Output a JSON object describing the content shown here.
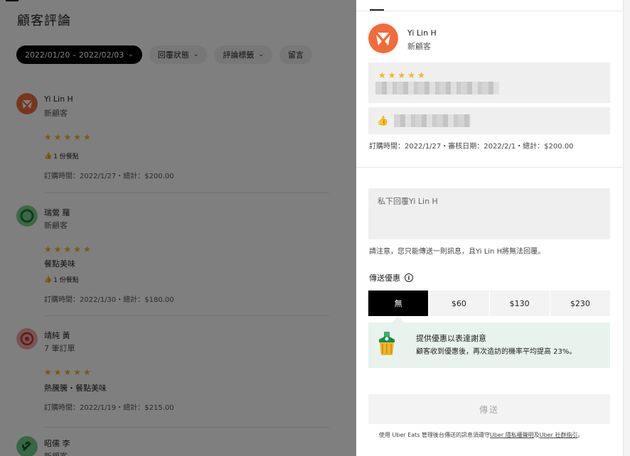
{
  "page": {
    "title": "顧客評論"
  },
  "filters": [
    {
      "label": "2022/01/20 – 2022/02/03",
      "has_chevron": true,
      "active": true
    },
    {
      "label": "回覆狀態",
      "has_chevron": true,
      "active": false
    },
    {
      "label": "評論標籤",
      "has_chevron": true,
      "active": false
    },
    {
      "label": "留言",
      "has_chevron": false,
      "active": false
    }
  ],
  "reviews": [
    {
      "name": "Yi Lin H",
      "subtitle": "新顧客",
      "rating": 5,
      "tags": "",
      "likes": "1 份餐點",
      "meta": "訂購時間：2022/1/27・總計：$200.00",
      "avatar_color": "#f26b3a",
      "avatar_icon": "tri-wedge-icon"
    },
    {
      "name": "瑞鶯 羅",
      "subtitle": "新顧客",
      "rating": 5,
      "tags": "餐點美味",
      "likes": "1 份餐點",
      "meta": "訂購時間：2022/1/30・總計：$180.00",
      "avatar_color": "#7ad08a",
      "avatar_icon": "ring-icon"
    },
    {
      "name": "靖純 黃",
      "subtitle": "7 筆訂單",
      "rating": 5,
      "tags": "熱騰騰・餐點美味",
      "likes": "",
      "meta": "訂購時間：2022/1/19・總計：$215.00",
      "avatar_color": "#f3a7a7",
      "avatar_icon": "target-icon"
    },
    {
      "name": "昭儒 李",
      "subtitle": "新顧客",
      "rating": 0,
      "tags": "",
      "likes": "",
      "meta": "",
      "avatar_color": "#6fcf8a",
      "avatar_icon": "leaf-icon"
    }
  ],
  "detail": {
    "name": "Yi Lin H",
    "subtitle": "新顧客",
    "rating": 5,
    "meta": "訂購時間：2022/1/27・審核日期：2022/2/1・總計：$200.00",
    "reply_placeholder": "私下回覆Yi Lin H",
    "note": "請注意，您只能傳送一則訊息，且Yi Lin H將無法回覆。",
    "offer_title": "傳送優惠",
    "offer_options": [
      "無",
      "$60",
      "$130",
      "$230"
    ],
    "selected_offer": 0,
    "promo_title": "提供優惠以表達謝意",
    "promo_text": "顧客收到優惠後，再次造訪的機率平均提高 23%。",
    "send_label": "傳送",
    "footer_pre": "使用 Uber Eats 管理後台傳送的訊息須遵守",
    "footer_link1": "Uber 隱私權聲明",
    "footer_mid": "及",
    "footer_link2": "Uber 社群指引",
    "footer_post": "。"
  },
  "colors": {
    "accent_orange": "#f26b3a",
    "star": "#f0b429",
    "promo_bg": "#e8f3ee"
  }
}
